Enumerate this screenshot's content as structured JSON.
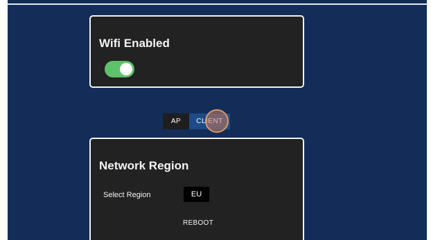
{
  "wifi_card": {
    "title": "Wifi Enabled",
    "toggle_state": "on",
    "toggle_color": "#5ec26a"
  },
  "mode_switch": {
    "options": [
      "AP",
      "CLIENT"
    ],
    "selected": "CLIENT"
  },
  "region_card": {
    "title": "Network Region",
    "select_label": "Select Region",
    "selected_region": "EU",
    "reboot_label": "REBOOT"
  },
  "colors": {
    "background": "#132d58",
    "card": "#222222",
    "accent": "#1d4b87"
  }
}
